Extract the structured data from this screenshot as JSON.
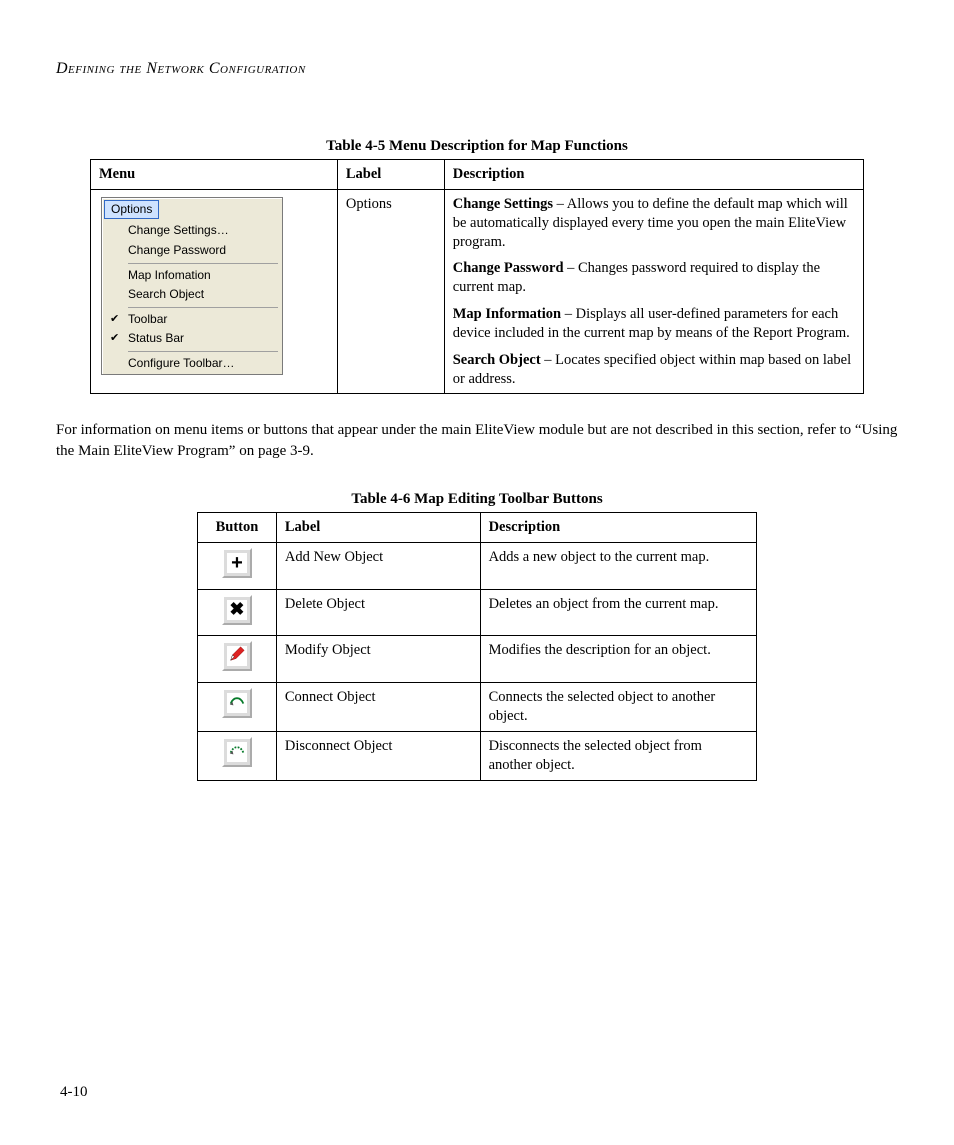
{
  "header": "Defining the Network Configuration",
  "page_number": "4-10",
  "table1": {
    "caption": "Table 4-5  Menu Description for Map Functions",
    "headers": {
      "menu": "Menu",
      "label": "Label",
      "description": "Description"
    },
    "label": "Options",
    "menu_screenshot": {
      "title": "Options",
      "items": [
        {
          "text": "Change Settings…",
          "checked": false
        },
        {
          "text": "Change Password",
          "checked": false
        },
        {
          "sep": true
        },
        {
          "text": "Map Infomation",
          "checked": false
        },
        {
          "text": "Search Object",
          "checked": false
        },
        {
          "sep": true
        },
        {
          "text": "Toolbar",
          "checked": true
        },
        {
          "text": "Status Bar",
          "checked": true
        },
        {
          "sep": true
        },
        {
          "text": "Configure Toolbar…",
          "checked": false
        }
      ]
    },
    "descriptions": [
      {
        "bold": "Change Settings",
        "rest": " – Allows you to define the default map which will be automatically displayed every time you open the main EliteView program."
      },
      {
        "bold": "Change Password",
        "rest": " – Changes password required to display the current map."
      },
      {
        "bold": "Map Information",
        "rest": " – Displays all user-defined parameters for each device included in the current map by means of the Report Program."
      },
      {
        "bold": "Search Object",
        "rest": " – Locates specified object within map based on label or address."
      }
    ]
  },
  "body_para": "For information on menu items or buttons that appear under the main EliteView module but are not described in this section, refer to “Using the Main EliteView Program” on page 3-9.",
  "table2": {
    "caption": "Table 4-6  Map Editing Toolbar Buttons",
    "headers": {
      "button": "Button",
      "label": "Label",
      "description": "Description"
    },
    "rows": [
      {
        "icon": "plus",
        "label": "Add New Object",
        "desc": "Adds a new object to the current map."
      },
      {
        "icon": "cross",
        "label": "Delete Object",
        "desc": "Deletes an object from the current map."
      },
      {
        "icon": "pencil",
        "label": "Modify Object",
        "desc": "Modifies the description for an object."
      },
      {
        "icon": "connect",
        "label": "Connect Object",
        "desc": "Connects the selected object to another object."
      },
      {
        "icon": "disconnect",
        "label": "Disconnect Object",
        "desc": "Disconnects the selected object from another object."
      }
    ]
  }
}
